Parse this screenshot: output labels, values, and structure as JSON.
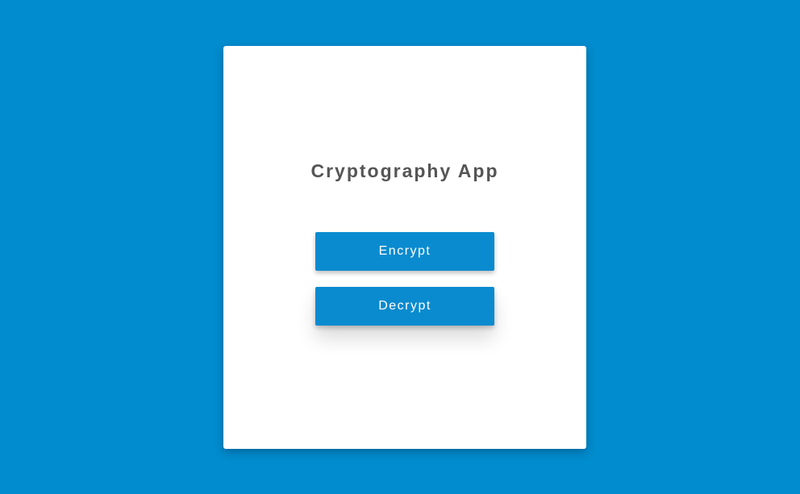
{
  "app": {
    "title": "Cryptography App"
  },
  "actions": {
    "encrypt_label": "Encrypt",
    "decrypt_label": "Decrypt"
  },
  "colors": {
    "background": "#008CCE",
    "card": "#FFFFFF",
    "button": "#0A8BCF",
    "title_text": "#555555"
  }
}
